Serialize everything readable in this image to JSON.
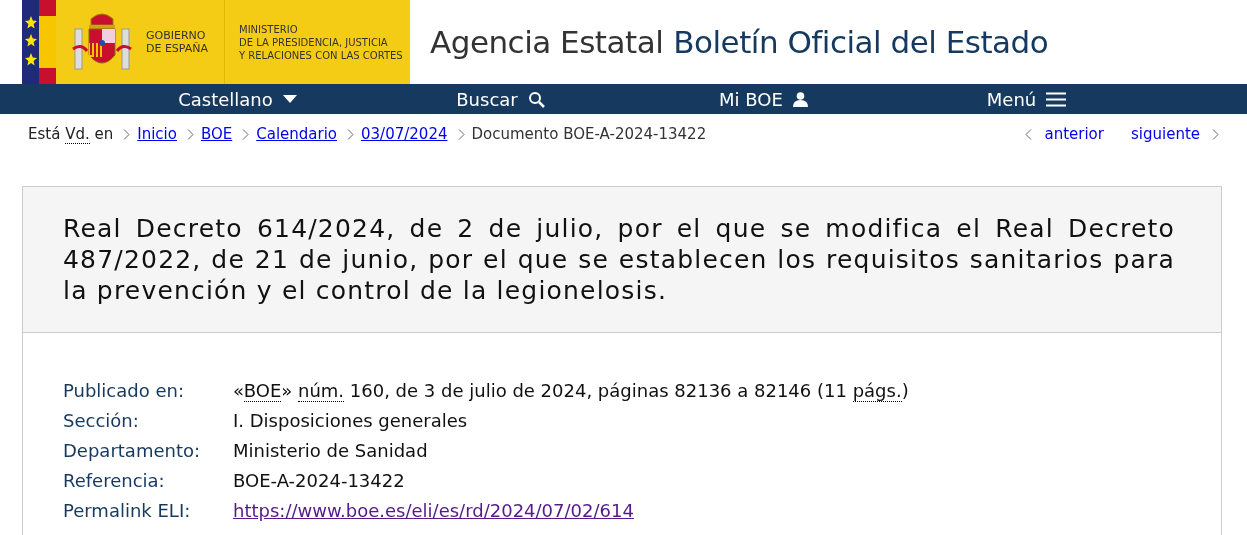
{
  "header": {
    "logo_gov": [
      "GOBIERNO",
      "DE ESPAÑA"
    ],
    "logo_ministry": [
      "MINISTERIO",
      "DE LA PRESIDENCIA, JUSTICIA",
      "Y RELACIONES CON LAS CORTES"
    ],
    "title_prefix": "Agencia Estatal",
    "title_main": "Boletín Oficial del Estado"
  },
  "nav": [
    {
      "label": "Castellano",
      "kind": "caret"
    },
    {
      "label": "Buscar",
      "kind": "search"
    },
    {
      "label": "Mi BOE",
      "kind": "user"
    },
    {
      "label": "Menú",
      "kind": "menu"
    }
  ],
  "breadcrumb": {
    "prefix": [
      {
        "text": "Está "
      },
      {
        "text": "Vd.",
        "abbr": true
      },
      {
        "text": " en"
      }
    ],
    "items": [
      {
        "label": "Inicio",
        "link": true
      },
      {
        "label": "BOE",
        "link": true
      },
      {
        "label": "Calendario",
        "link": true
      },
      {
        "label": "03/07/2024",
        "link": true
      },
      {
        "label": "Documento BOE-A-2024-13422",
        "link": false
      }
    ],
    "previous": "anterior",
    "next": "siguiente"
  },
  "document": {
    "title": "Real Decreto 614/2024, de 2 de julio, por el que se modifica el Real Decreto 487/2022, de 21 de junio, por el que se establecen los requisitos sanitarios para la prevención y el control de la legionelosis.",
    "fields": [
      {
        "label": "Publicado en:",
        "parts": [
          {
            "text": "«"
          },
          {
            "text": "BOE",
            "abbr": true
          },
          {
            "text": "» "
          },
          {
            "text": "núm.",
            "abbr": true
          },
          {
            "text": " 160, de 3 de julio de 2024, páginas 82136 a 82146 (11 "
          },
          {
            "text": "págs.",
            "abbr": true
          },
          {
            "text": ")"
          }
        ],
        "link": false
      },
      {
        "label": "Sección:",
        "parts": [
          {
            "text": "I. Disposiciones generales"
          }
        ],
        "link": false
      },
      {
        "label": "Departamento:",
        "parts": [
          {
            "text": "Ministerio de Sanidad"
          }
        ],
        "link": false
      },
      {
        "label": "Referencia:",
        "parts": [
          {
            "text": "BOE-A-2024-13422"
          }
        ],
        "link": false
      },
      {
        "label": "Permalink ELI:",
        "parts": [
          {
            "text": "https://www.boe.es/eli/es/rd/2024/07/02/614"
          }
        ],
        "link": true
      }
    ]
  }
}
